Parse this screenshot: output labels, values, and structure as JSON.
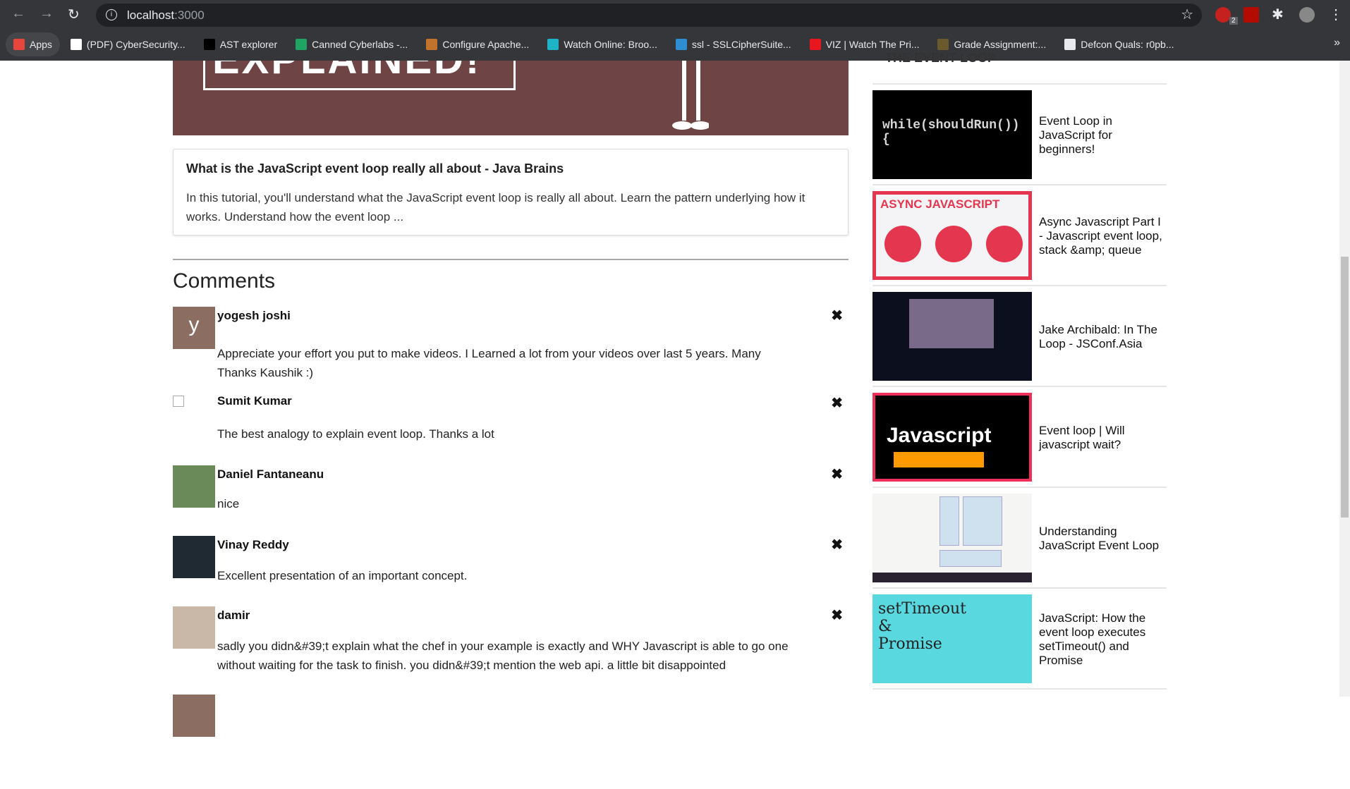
{
  "browser": {
    "url_host": "localhost",
    "url_port": ":3000",
    "ext_badge": "2",
    "bookmarks": [
      {
        "label": "Apps",
        "color": "#e8453c"
      },
      {
        "label": "(PDF) CyberSecurity...",
        "color": "#ffffff"
      },
      {
        "label": "AST explorer",
        "color": "#000000"
      },
      {
        "label": "Canned Cyberlabs -...",
        "color": "#1fa463"
      },
      {
        "label": "Configure Apache...",
        "color": "#c2732b"
      },
      {
        "label": "Watch Online: Broo...",
        "color": "#1fb3c6"
      },
      {
        "label": "ssl - SSLCipherSuite...",
        "color": "#2d8ed1"
      },
      {
        "label": "VIZ | Watch The Pri...",
        "color": "#e8161f"
      },
      {
        "label": "Grade Assignment:...",
        "color": "#6b5a2c"
      },
      {
        "label": "Defcon Quals: r0pb...",
        "color": "#e8eaed"
      }
    ]
  },
  "hero": {
    "text": "EXPLAINED!"
  },
  "video": {
    "title": "What is the JavaScript event loop really all about - Java Brains",
    "description": "In this tutorial, you'll understand what the JavaScript event loop is really all about. Learn the pattern underlying how it works. Understand how the event loop ..."
  },
  "comments_heading": "Comments",
  "comments": [
    {
      "name": "yogesh joshi",
      "initial": "y",
      "text": "Appreciate your effort you put to make videos. I Learned a lot from your videos over last 5 years. Many Thanks Kaushik :)"
    },
    {
      "name": "Sumit Kumar",
      "text": "The best analogy to explain event loop. Thanks a lot"
    },
    {
      "name": "Daniel Fantaneanu",
      "text": "nice"
    },
    {
      "name": "Vinay Reddy",
      "text": "Excellent presentation of an important concept."
    },
    {
      "name": "damir",
      "text": "sadly you didn&#39;t explain what the chef in your example is exactly and WHY Javascript is able to go one without waiting for the task to finish. you didn&#39;t mention the web api. a little bit disappointed"
    }
  ],
  "delete_icon": "✖",
  "related": {
    "top_partial": "THE EVENT LOOP",
    "items": [
      {
        "title": "Event Loop in JavaScript for beginners!",
        "thumb_text": "while(shouldRun()) {",
        "bg": "#000000",
        "fg": "#d7d7d7"
      },
      {
        "title": "Async Javascript Part I - Javascript event loop, stack &amp; queue",
        "thumb_text": "ASYNC JAVASCRIPT",
        "bg": "#e5364f",
        "fg": "#ffffff"
      },
      {
        "title": "Jake Archibald: In The Loop - JSConf.Asia",
        "thumb_text": "",
        "bg": "#0b0f1e",
        "fg": "#ffffff"
      },
      {
        "title": "Event loop | Will javascript wait?",
        "thumb_text": "Javascript",
        "bg": "#000000",
        "fg": "#ffffff"
      },
      {
        "title": "Understanding JavaScript Event Loop",
        "thumb_text": "",
        "bg": "#f5f5f3",
        "fg": "#333333"
      },
      {
        "title": "JavaScript: How the event loop executes setTimeout() and Promise",
        "thumb_text": "setTimeout & Promise",
        "bg": "#5ad8e0",
        "fg": "#222222"
      }
    ]
  }
}
